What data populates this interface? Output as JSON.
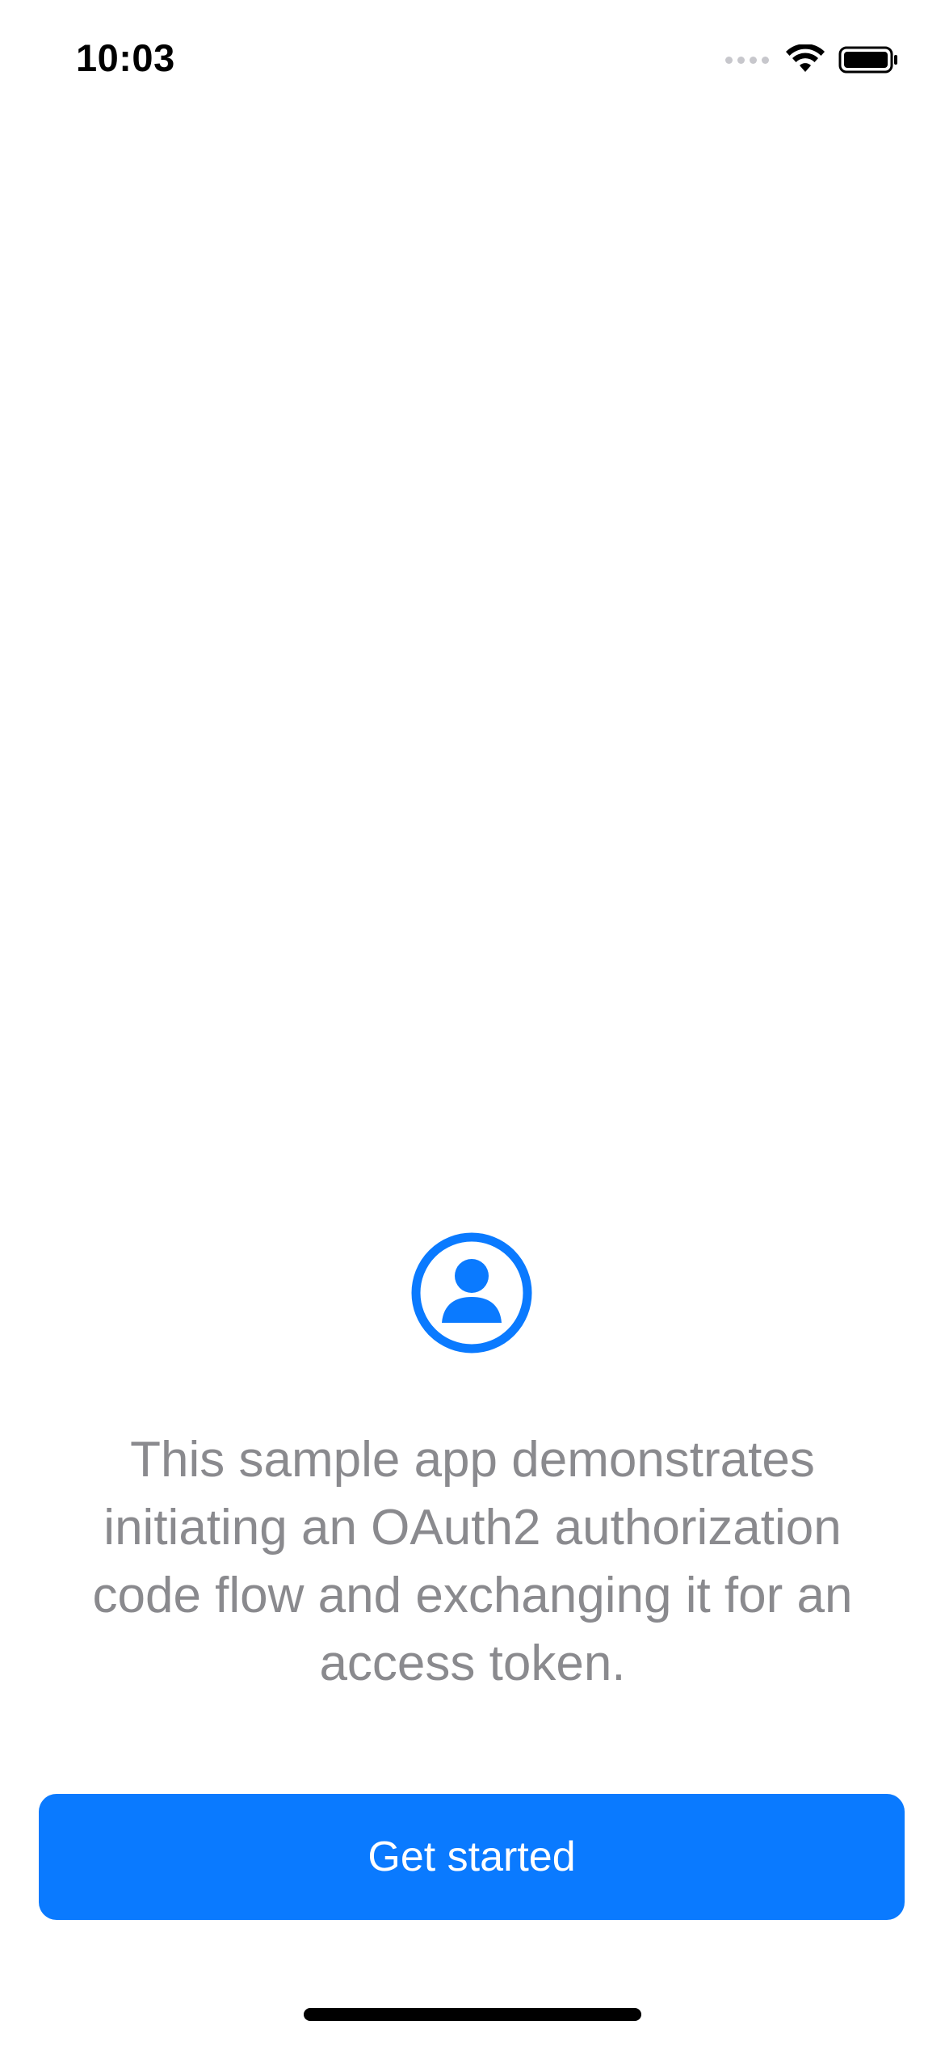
{
  "status_bar": {
    "time": "10:03",
    "icons": [
      "cellular-signal-icon",
      "wifi-icon",
      "battery-icon"
    ]
  },
  "main": {
    "icon": "person-circle-icon",
    "description": "This sample app demonstrates initiating an OAuth2 authorization code flow and exchanging it for an access token.",
    "button_label": "Get started"
  },
  "colors": {
    "accent": "#0a7aff",
    "description_text": "#8a8a8e",
    "background": "#ffffff"
  }
}
